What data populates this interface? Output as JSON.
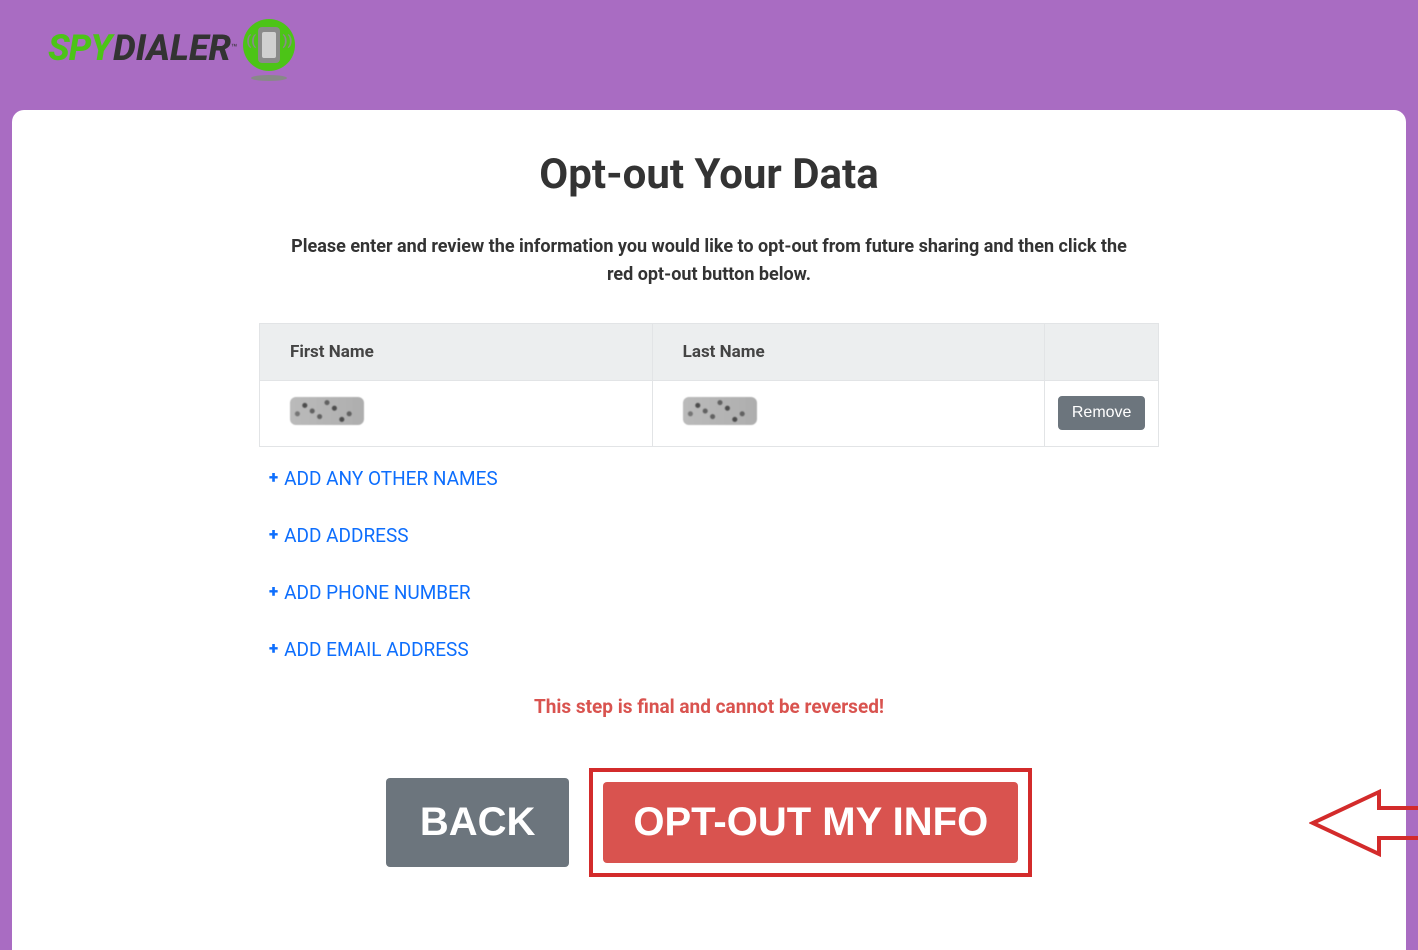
{
  "logo": {
    "spy": "SPY",
    "dialer": "DIALER",
    "tm": "™"
  },
  "heading": "Opt-out Your Data",
  "instruction": "Please enter and review the information you would like to opt-out from future sharing and then click the red opt-out button below.",
  "table": {
    "headers": {
      "first": "First Name",
      "last": "Last Name",
      "action": ""
    },
    "row": {
      "remove": "Remove"
    }
  },
  "addLinks": {
    "names": "ADD ANY OTHER NAMES",
    "address": "ADD ADDRESS",
    "phone": "ADD PHONE NUMBER",
    "email": "ADD EMAIL ADDRESS"
  },
  "plus": "+",
  "warning": "This step is final and cannot be reversed!",
  "buttons": {
    "back": "BACK",
    "optout": "OPT-OUT MY INFO"
  }
}
